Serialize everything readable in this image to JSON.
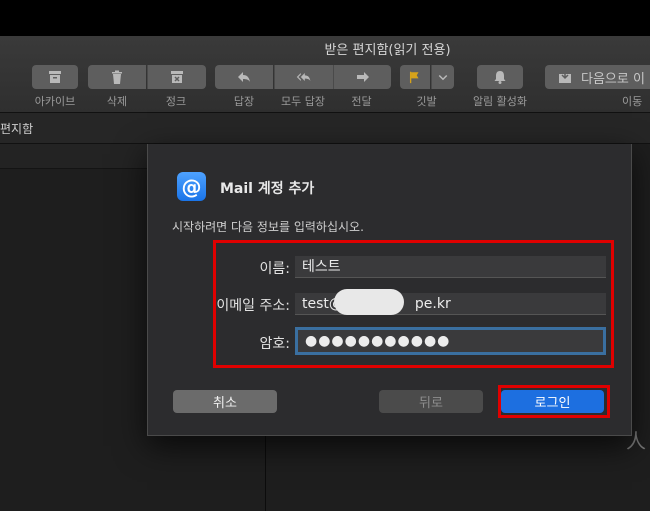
{
  "window": {
    "title": "받은 편지함(읽기 전용)"
  },
  "toolbar": {
    "archive_label": "아카이브",
    "delete_label": "삭제",
    "junk_label": "정크",
    "reply_label": "답장",
    "reply_all_label": "모두 답장",
    "forward_label": "전달",
    "flag_label": "깃발",
    "notify_label": "알림 활성화",
    "move_button_text": "다음으로 이",
    "move_label": "이동"
  },
  "subheader": {
    "title": "편지함"
  },
  "dialog": {
    "title": "Mail 계정 추가",
    "description": "시작하려면 다음 정보를 입력하십시오.",
    "name_label": "이름:",
    "name_value": "테스트",
    "email_label": "이메일 주소:",
    "email_value_prefix": "test@",
    "email_value_suffix": "pe.kr",
    "password_label": "암호:",
    "password_value": "●●●●●●●●●●●",
    "cancel_label": "취소",
    "back_label": "뒤로",
    "login_label": "로그인"
  },
  "colors": {
    "accent": "#1d6fe0",
    "highlight": "#e00000",
    "mail_icon": "#1a74e8"
  },
  "icons": {
    "archive": "archive-icon",
    "delete": "trash-icon",
    "junk": "junk-icon",
    "reply": "reply-icon",
    "reply_all": "reply-all-icon",
    "forward": "forward-icon",
    "flag": "flag-icon",
    "notify": "bell-icon",
    "move": "move-icon",
    "mail": "mail-at-icon"
  },
  "message_glyph": "人"
}
